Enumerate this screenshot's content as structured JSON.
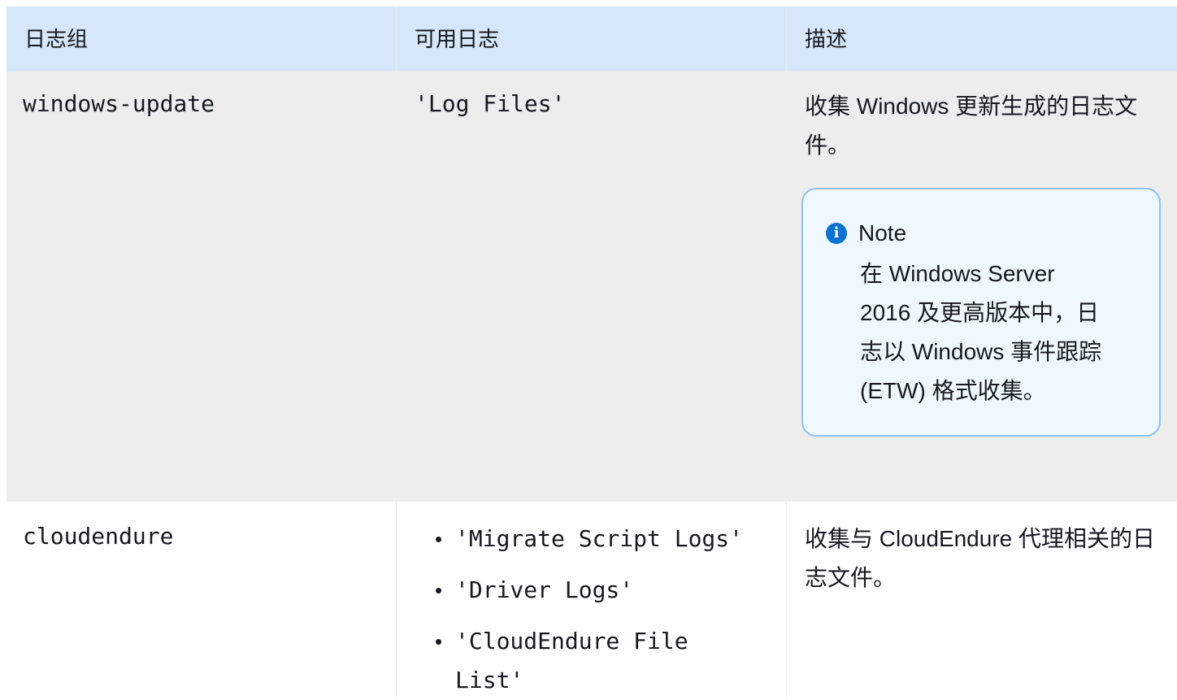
{
  "table": {
    "headers": [
      "日志组",
      "可用日志",
      "描述"
    ],
    "rows": [
      {
        "log_group": "windows-update",
        "available_logs": [
          "'Log Files'"
        ],
        "description": "收集 Windows 更新生成的日志文件。",
        "note": {
          "title": "Note",
          "body": "在 Windows Server 2016 及更高版本中，日志以 Windows 事件跟踪 (ETW) 格式收集。"
        }
      },
      {
        "log_group": "cloudendure",
        "available_logs": [
          "'Migrate Script Logs'",
          "'Driver Logs'",
          "'CloudEndure File List'"
        ],
        "description": "收集与 CloudEndure 代理相关的日志文件。"
      }
    ]
  },
  "icons": {
    "note_icon": "info-icon"
  },
  "colors": {
    "header_bg": "#d5e7f8",
    "row_alt_bg": "#ededee",
    "note_border": "#8cc3f2",
    "note_bg": "#f0f8ff",
    "info_icon": "#0972d3"
  }
}
